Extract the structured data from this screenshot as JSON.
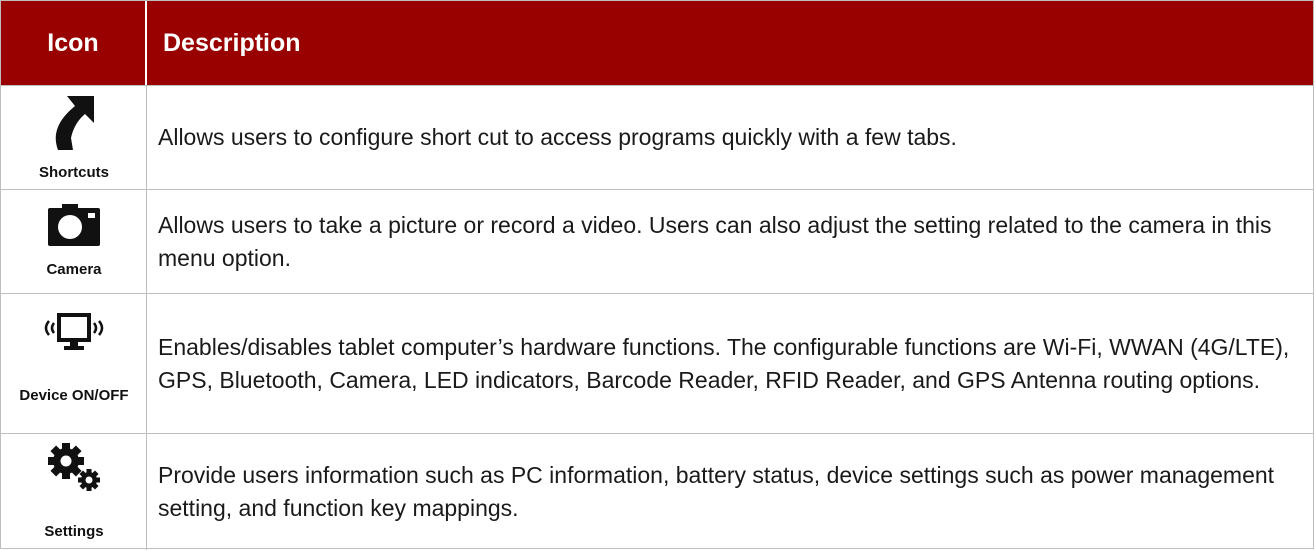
{
  "table": {
    "headers": {
      "icon": "Icon",
      "description": "Description"
    },
    "rows": [
      {
        "icon_name": "shortcut-arrow-icon",
        "label": "Shortcuts",
        "description": "Allows users to configure short cut to access programs quickly with a few tabs."
      },
      {
        "icon_name": "camera-icon",
        "label": "Camera",
        "description": "Allows users to take a picture or record a video. Users can also adjust the setting related to the camera in this menu option."
      },
      {
        "icon_name": "monitor-wireless-icon",
        "label": "Device ON/OFF",
        "description": "Enables/disables tablet computer’s hardware functions. The configurable functions are Wi-Fi, WWAN (4G/LTE), GPS, Bluetooth, Camera, LED indicators, Barcode Reader, RFID Reader, and GPS Antenna routing options."
      },
      {
        "icon_name": "gears-icon",
        "label": "Settings",
        "description": "Provide users information such as PC information, battery status, device settings such as power management setting, and function key mappings."
      }
    ]
  },
  "colors": {
    "header_background": "#990000",
    "header_text": "#ffffff",
    "border": "#bdbdbd",
    "icon": "#111111"
  }
}
